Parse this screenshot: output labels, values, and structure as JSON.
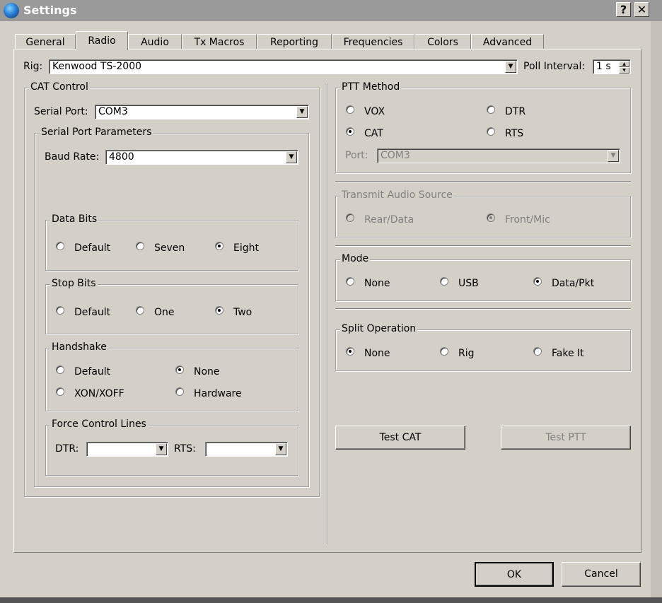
{
  "window": {
    "title": "Settings",
    "help_glyph": "?",
    "close_glyph": "✕"
  },
  "tabs": [
    {
      "label": "General"
    },
    {
      "label": "Radio",
      "active": true
    },
    {
      "label": "Audio"
    },
    {
      "label": "Tx Macros"
    },
    {
      "label": "Reporting"
    },
    {
      "label": "Frequencies"
    },
    {
      "label": "Colors"
    },
    {
      "label": "Advanced"
    }
  ],
  "rig": {
    "label": "Rig:",
    "value": "Kenwood TS-2000",
    "poll_label": "Poll Interval:",
    "poll_value": "1 s"
  },
  "cat": {
    "title": "CAT Control",
    "serial_label": "Serial Port:",
    "serial_value": "COM3",
    "params_title": "Serial Port Parameters",
    "baud_label": "Baud Rate:",
    "baud_value": "4800",
    "data_bits": {
      "title": "Data Bits",
      "options": [
        "Default",
        "Seven",
        "Eight"
      ],
      "selected": "Eight"
    },
    "stop_bits": {
      "title": "Stop Bits",
      "options": [
        "Default",
        "One",
        "Two"
      ],
      "selected": "Two"
    },
    "handshake": {
      "title": "Handshake",
      "options": [
        "Default",
        "None",
        "XON/XOFF",
        "Hardware"
      ],
      "selected": "None"
    },
    "force": {
      "title": "Force Control Lines",
      "dtr_label": "DTR:",
      "dtr_value": "",
      "rts_label": "RTS:",
      "rts_value": ""
    }
  },
  "ptt": {
    "title": "PTT Method",
    "options": [
      "VOX",
      "DTR",
      "CAT",
      "RTS"
    ],
    "selected": "CAT",
    "port_label": "Port:",
    "port_value": "COM3"
  },
  "tx_audio": {
    "title": "Transmit Audio Source",
    "options": [
      "Rear/Data",
      "Front/Mic"
    ],
    "selected": "Front/Mic"
  },
  "mode": {
    "title": "Mode",
    "options": [
      "None",
      "USB",
      "Data/Pkt"
    ],
    "selected": "Data/Pkt"
  },
  "split": {
    "title": "Split Operation",
    "options": [
      "None",
      "Rig",
      "Fake It"
    ],
    "selected": "None"
  },
  "buttons": {
    "test_cat": "Test CAT",
    "test_ptt": "Test PTT",
    "ok": "OK",
    "cancel": "Cancel"
  },
  "arrow_glyph": "▼",
  "up_glyph": "▲",
  "down_glyph": "▼"
}
